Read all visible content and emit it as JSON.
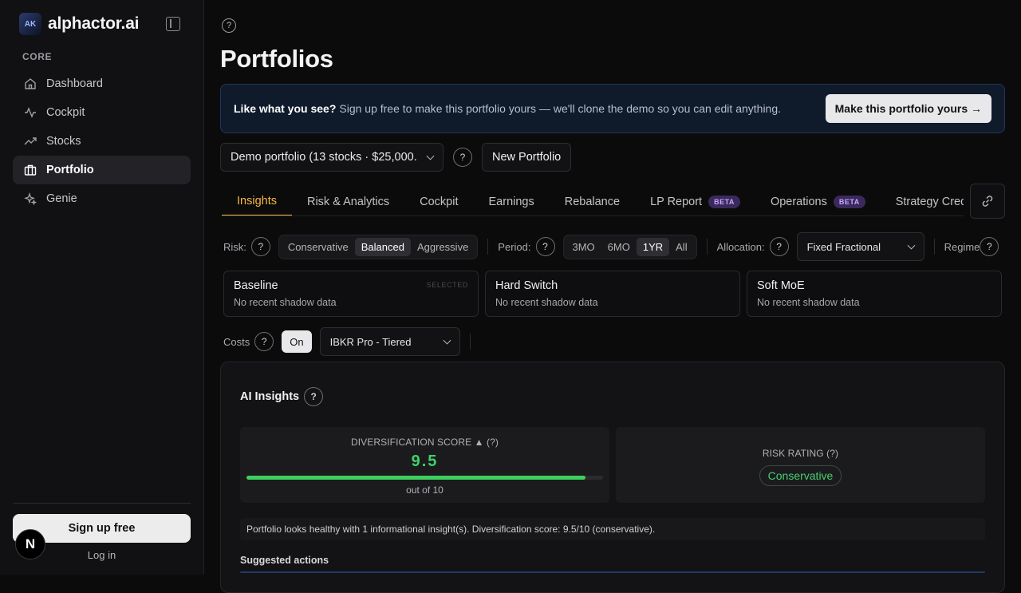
{
  "brand": {
    "name": "alphactor.ai",
    "logo_text": "AK"
  },
  "sidebar": {
    "section": "CORE",
    "items": [
      {
        "label": "Dashboard",
        "icon": "home-icon"
      },
      {
        "label": "Cockpit",
        "icon": "activity-icon"
      },
      {
        "label": "Stocks",
        "icon": "trending-up-icon"
      },
      {
        "label": "Portfolio",
        "icon": "briefcase-icon",
        "active": true
      },
      {
        "label": "Genie",
        "icon": "sparkles-icon"
      }
    ],
    "signup_label": "Sign up free",
    "login_label": "Log in",
    "badge_letter": "N"
  },
  "page": {
    "title": "Portfolios",
    "help": "?"
  },
  "banner": {
    "lead": "Like what you see?",
    "text": "Sign up free to make this portfolio yours — we'll clone the demo so you can edit anything.",
    "cta": "Make this portfolio yours →"
  },
  "portfolio": {
    "selected": "Demo portfolio (13 stocks · $25,000.",
    "help": "?",
    "new_label": "New Portfolio"
  },
  "tabs": [
    {
      "label": "Insights",
      "active": true
    },
    {
      "label": "Risk & Analytics"
    },
    {
      "label": "Cockpit"
    },
    {
      "label": "Earnings"
    },
    {
      "label": "Rebalance"
    },
    {
      "label": "LP Report",
      "badge": "BETA"
    },
    {
      "label": "Operations",
      "badge": "BETA"
    },
    {
      "label": "Strategy Credi"
    }
  ],
  "controls": {
    "risk_label": "Risk:",
    "risk_options": [
      "Conservative",
      "Balanced",
      "Aggressive"
    ],
    "risk_selected": "Balanced",
    "period_label": "Period:",
    "period_options": [
      "3MO",
      "6MO",
      "1YR",
      "All"
    ],
    "period_selected": "1YR",
    "allocation_label": "Allocation:",
    "allocation_value": "Fixed Fractional",
    "regime_label": "Regime",
    "help": "?"
  },
  "strategies": [
    {
      "title": "Baseline",
      "sub": "No recent shadow data",
      "tag": "SELECTED"
    },
    {
      "title": "Hard Switch",
      "sub": "No recent shadow data"
    },
    {
      "title": "Soft MoE",
      "sub": "No recent shadow data"
    }
  ],
  "costs": {
    "label": "Costs",
    "help": "?",
    "toggle": "On",
    "broker": "IBKR Pro - Tiered"
  },
  "insights": {
    "title": "AI Insights",
    "help": "?",
    "diversification_label": "DIVERSIFICATION SCORE ▲  (?)",
    "score": "9.5",
    "score_fraction": 0.95,
    "out_of": "out of 10",
    "risk_label": "RISK RATING  (?)",
    "risk_value": "Conservative",
    "summary": "Portfolio looks healthy with 1 informational insight(s). Diversification score: 9.5/10 (conservative).",
    "suggested_label": "Suggested actions"
  }
}
